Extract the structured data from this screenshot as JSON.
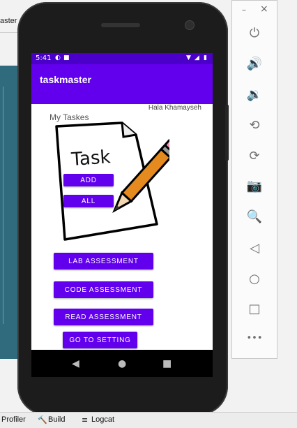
{
  "ide": {
    "window_title_fragment": "aster",
    "bottom_tabs": [
      {
        "icon": "",
        "label": "Profiler"
      },
      {
        "icon": "🔨",
        "label": "Build"
      },
      {
        "icon": "≡",
        "label": "Logcat"
      }
    ]
  },
  "emulator_panel": {
    "header": {
      "minimize": "–",
      "close": "×"
    },
    "controls": [
      {
        "name": "power-icon",
        "glyph": "⏻"
      },
      {
        "name": "volume-up-icon",
        "glyph": "🔊"
      },
      {
        "name": "volume-down-icon",
        "glyph": "🔉"
      },
      {
        "name": "rotate-left-icon",
        "glyph": "⟲"
      },
      {
        "name": "rotate-right-icon",
        "glyph": "⟳"
      },
      {
        "name": "screenshot-icon",
        "glyph": "📷"
      },
      {
        "name": "zoom-icon",
        "glyph": "🔍"
      },
      {
        "name": "back-icon",
        "glyph": "◁"
      },
      {
        "name": "home-icon",
        "glyph": "○"
      },
      {
        "name": "overview-icon",
        "glyph": "□"
      },
      {
        "name": "more-icon",
        "glyph": "•••"
      }
    ]
  },
  "device": {
    "status_bar": {
      "time": "5:41",
      "left_icons": [
        "◐",
        "■"
      ],
      "right_icons": [
        "▼",
        "◢",
        "▮"
      ]
    },
    "app_bar": {
      "title": "taskmaster"
    },
    "author": "Hala Khamayseh",
    "heading": "My Taskes",
    "illustration": {
      "text": "Task"
    },
    "buttons": {
      "add": "ADD",
      "all": "ALL",
      "lab": "LAB ASSESSMENT",
      "code": "CODE ASSESSMENT",
      "read": "READ ASSESSMENT",
      "settings": "GO TO SETTING"
    },
    "nav_bar": {
      "back": "◀",
      "home": "●",
      "recents": "■"
    }
  },
  "colors": {
    "primary": "#6200ee",
    "status_bar": "#4a00c8",
    "screen_bg": "#ffffff"
  }
}
